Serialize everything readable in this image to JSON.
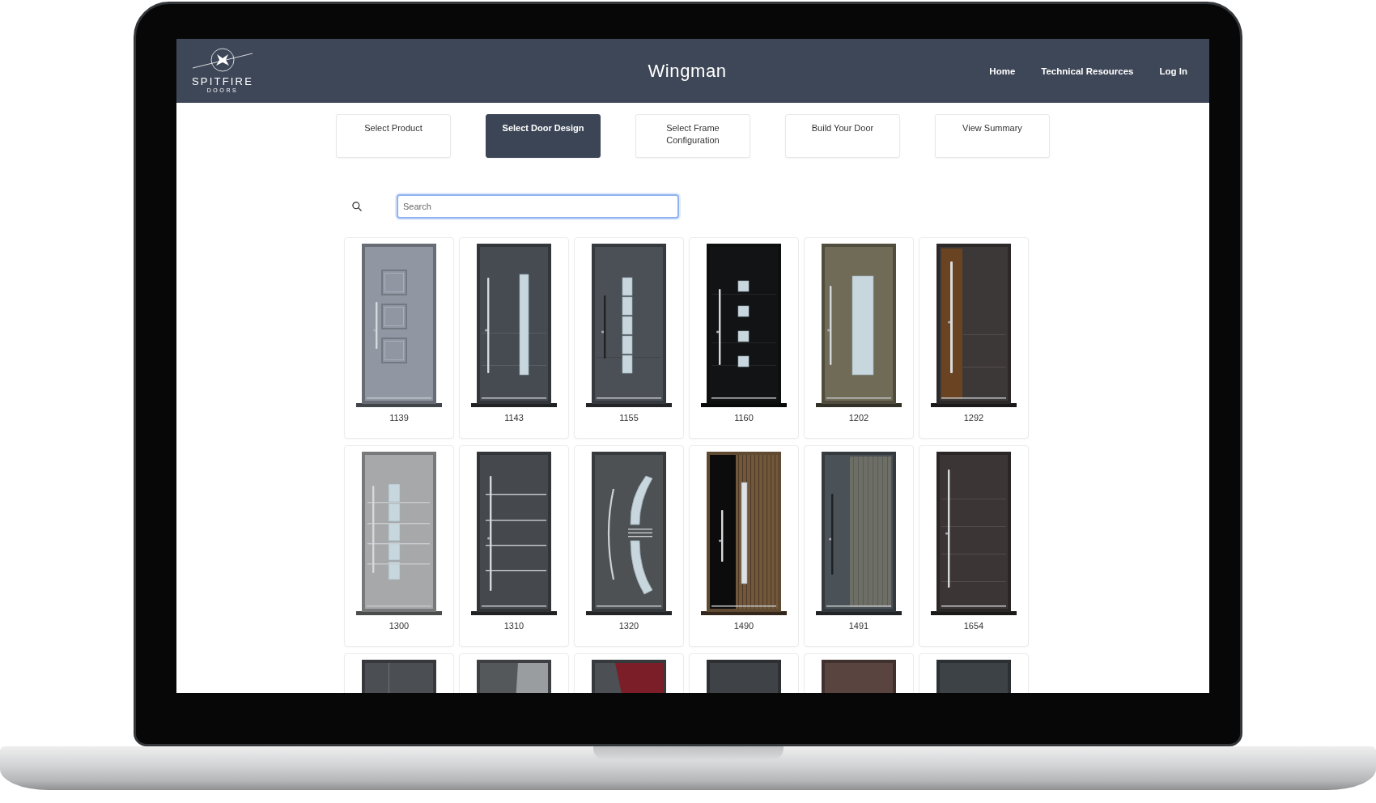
{
  "header": {
    "logo": {
      "wordmark": "SPITFIRE",
      "subtitle": "DOORS"
    },
    "title": "Wingman",
    "nav": [
      {
        "label": "Home"
      },
      {
        "label": "Technical Resources"
      },
      {
        "label": "Log In"
      }
    ]
  },
  "steps": [
    {
      "label": "Select Product",
      "selected": false
    },
    {
      "label": "Select Door Design",
      "selected": true
    },
    {
      "label": "Select Frame Configuration",
      "selected": false
    },
    {
      "label": "Build Your Door",
      "selected": false
    },
    {
      "label": "View Summary",
      "selected": false
    }
  ],
  "search": {
    "placeholder": "Search",
    "focused": true
  },
  "doors": [
    {
      "code": "1139",
      "kind": "raised-panels",
      "color": "#9097a3"
    },
    {
      "code": "1143",
      "kind": "glass-strip",
      "color": "#464b51"
    },
    {
      "code": "1155",
      "kind": "glass-blocks",
      "color": "#4b5056"
    },
    {
      "code": "1160",
      "kind": "glass-squares",
      "color": "#121314"
    },
    {
      "code": "1202",
      "kind": "glass-panel",
      "color": "#6f6b56"
    },
    {
      "code": "1292",
      "kind": "wood-inlay",
      "color": "#3d3838"
    },
    {
      "code": "1300",
      "kind": "glass-rails",
      "color": "#a7a8a9"
    },
    {
      "code": "1310",
      "kind": "rails",
      "color": "#45494d"
    },
    {
      "code": "1320",
      "kind": "arc-glass",
      "color": "#4d5153"
    },
    {
      "code": "1490",
      "kind": "wood-slats",
      "color": "#72573b"
    },
    {
      "code": "1491",
      "kind": "fluted-panel",
      "color": "#4a5157"
    },
    {
      "code": "1654",
      "kind": "grooves",
      "color": "#3c3535"
    },
    {
      "kind": "vertical-groove",
      "color": "#4b4e52"
    },
    {
      "kind": "two-tone",
      "color": "#55585b"
    },
    {
      "kind": "red-accent",
      "color": "#4c5054"
    },
    {
      "kind": "plain",
      "color": "#3f4347"
    },
    {
      "kind": "plain",
      "color": "#5a4440"
    },
    {
      "kind": "plain",
      "color": "#3d4246"
    }
  ]
}
